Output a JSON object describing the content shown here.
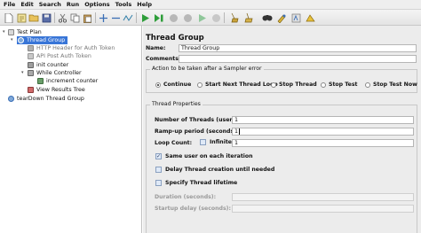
{
  "menu": [
    "File",
    "Edit",
    "Search",
    "Run",
    "Options",
    "Tools",
    "Help"
  ],
  "toolbar_icons": [
    "new-icon",
    "templates-icon",
    "open-icon",
    "save-icon",
    "cut-icon",
    "copy-icon",
    "paste-icon",
    "expand-icon",
    "collapse-icon",
    "toggle-icon",
    "start-icon",
    "start-no-pauses-icon",
    "stop-icon",
    "shutdown-icon",
    "remote-start-icon",
    "remote-stop-icon",
    "clear-icon",
    "clear-all-icon",
    "search-icon",
    "reset-search-icon",
    "function-helper-icon",
    "help-icon"
  ],
  "tree": {
    "test_plan": "Test Plan",
    "thread_group": "Thread Group",
    "http_header": "HTTP Header for Auth Token",
    "api_post": "API Post Auth Token",
    "init_counter": "init counter",
    "while_controller": "While Controller",
    "increment_counter": "increment counter",
    "view_results": "View Results Tree",
    "teardown": "tearDown Thread Group"
  },
  "panel": {
    "title": "Thread Group",
    "name_label": "Name:",
    "name_value": "Thread Group",
    "comments_label": "Comments:",
    "comments_value": "",
    "error_action_legend": "Action to be taken after a Sampler error",
    "error_actions": [
      "Continue",
      "Start Next Thread Loop",
      "Stop Thread",
      "Stop Test",
      "Stop Test Now"
    ],
    "selected_error_action": "Continue",
    "thread_props_legend": "Thread Properties",
    "threads_label": "Number of Threads (users):",
    "threads_value": "1",
    "rampup_label": "Ramp-up period (seconds):",
    "rampup_value": "1",
    "loop_label": "Loop Count:",
    "infinite_label": "Infinite",
    "infinite_checked": false,
    "loop_value": "1",
    "same_user_label": "Same user on each iteration",
    "same_user_checked": true,
    "delay_label": "Delay Thread creation until needed",
    "delay_checked": false,
    "specify_lifetime_label": "Specify Thread lifetime",
    "specify_lifetime_checked": false,
    "duration_label": "Duration (seconds):",
    "duration_value": "",
    "startup_delay_label": "Startup delay (seconds):",
    "startup_delay_value": ""
  },
  "colors": {
    "selection": "#3875d7",
    "panel_bg": "#ececec",
    "start_green": "#2e9e3a"
  }
}
